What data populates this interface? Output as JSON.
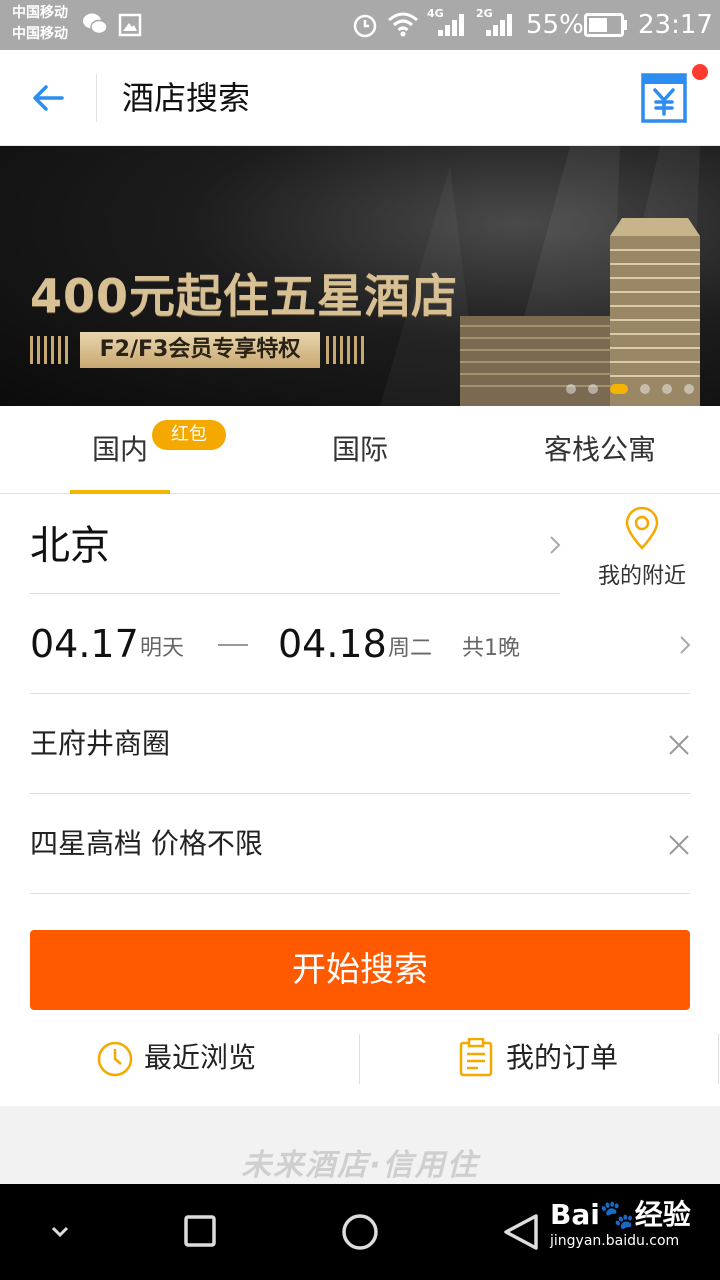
{
  "status_bar": {
    "carrier_1": "中国移动",
    "carrier_2": "中国移动",
    "net_1": "4G",
    "net_2": "2G",
    "battery": "55%",
    "time": "23:17"
  },
  "header": {
    "title": "酒店搜索",
    "accent_color": "#2d8cf0"
  },
  "banner": {
    "title": "400元起住五星酒店",
    "subtitle": "F2/F3会员专享特权",
    "slide_count": 6,
    "active_slide": 3
  },
  "tabs": {
    "items": [
      {
        "label": "国内"
      },
      {
        "label": "国际"
      },
      {
        "label": "客栈公寓"
      }
    ],
    "badge": "红包",
    "active": 0
  },
  "form": {
    "city": "北京",
    "nearby_label": "我的附近",
    "checkin_date": "04.17",
    "checkin_day": "明天",
    "checkout_date": "04.18",
    "checkout_day": "周二",
    "nights": "共1晚",
    "keyword": "王府井商圈",
    "star_price": "四星高档 价格不限",
    "search_button": "开始搜索",
    "search_color": "#ff5a00"
  },
  "quick_links": {
    "recent": "最近浏览",
    "orders": "我的订单"
  },
  "footer": {
    "slogan": "未来酒店·信用住"
  },
  "watermark": {
    "brand": "Bai",
    "brand_suffix": "经验",
    "url": "jingyan.baidu.com"
  }
}
